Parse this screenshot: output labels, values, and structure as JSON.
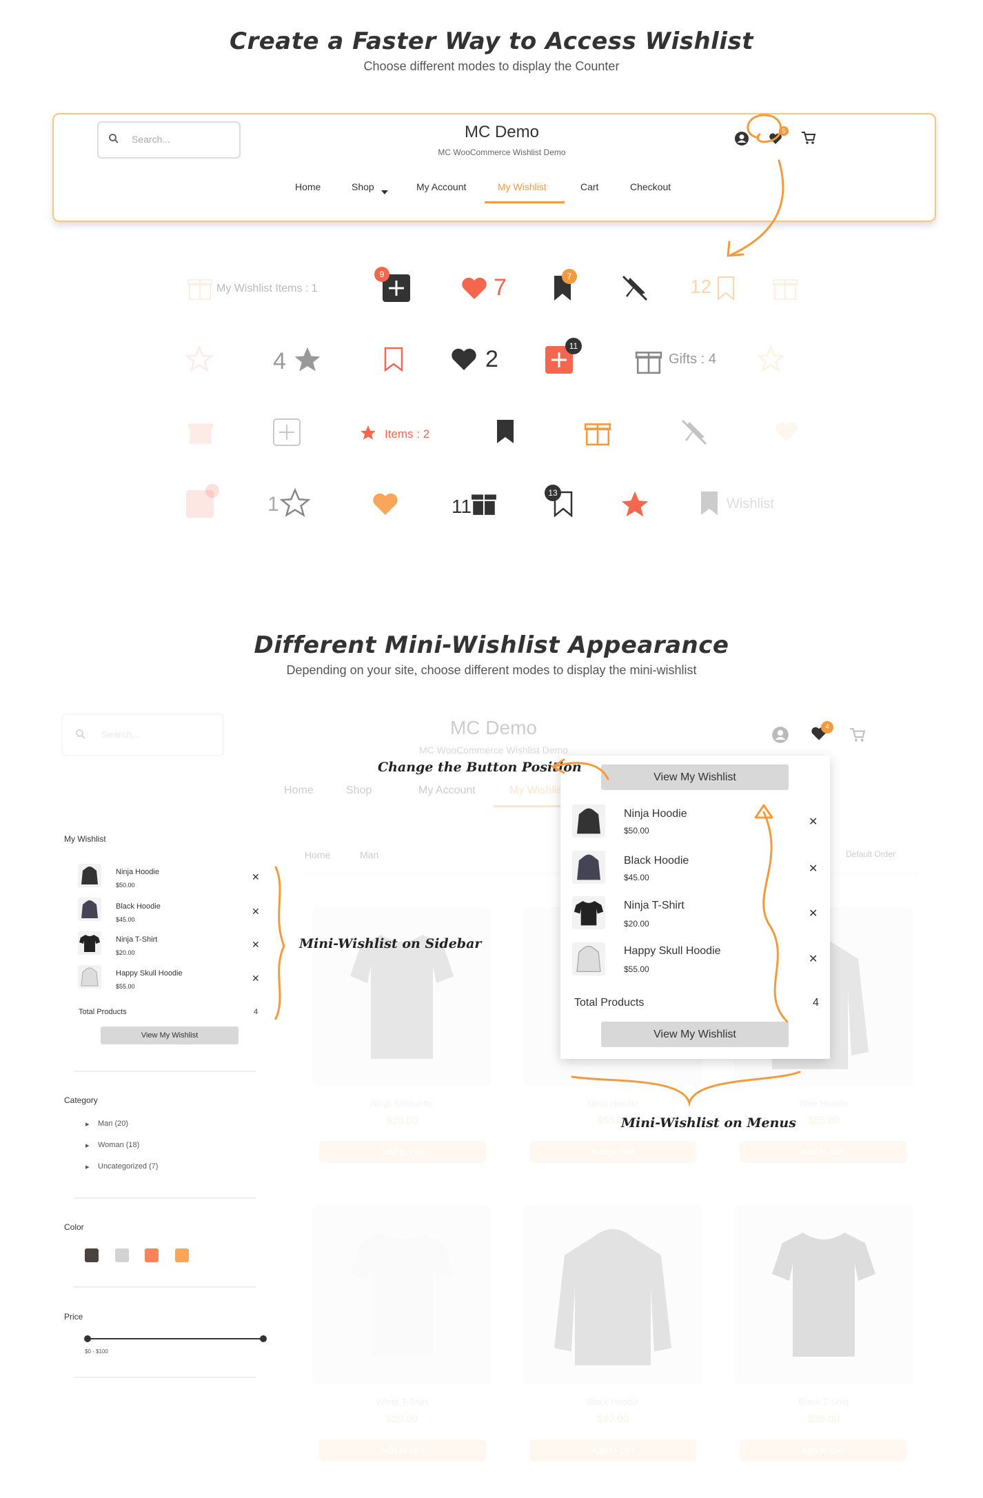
{
  "section1": {
    "title": "Create a Faster Way to Access Wishlist",
    "subtitle": "Choose different modes to display the Counter"
  },
  "demo_header": {
    "search_placeholder": "Search...",
    "site_title": "MC Demo",
    "tagline": "MC WooCommerce Wishlist Demo",
    "wishlist_badge": "5",
    "nav": [
      "Home",
      "Shop",
      "My Account",
      "My Wishlist",
      "Cart",
      "Checkout"
    ]
  },
  "counters": {
    "row1": {
      "my_wishlist_items": "My Wishlist Items : 1",
      "plus_badge": "9",
      "heart_count": "7",
      "bookmark_badge": "7",
      "bookmark_count": "12"
    },
    "row2": {
      "star_count": "4",
      "heart_count": "2",
      "plus_badge": "11",
      "gifts": "Gifts : 4"
    },
    "row3": {
      "items": "Items : 2"
    },
    "row4": {
      "star_count": "1",
      "gift_count": "11",
      "bookmark_badge": "13",
      "wishlist": "Wishlist"
    }
  },
  "section2": {
    "title": "Different Mini-Wishlist Appearance",
    "subtitle": "Depending on your site, choose different modes to display the mini-wishlist"
  },
  "mock_store": {
    "search_placeholder": "Search...",
    "site_title": "MC Demo",
    "tagline": "MC WooCommerce Wishlist Demo",
    "wishlist_badge": "4",
    "nav": [
      "Home",
      "Shop",
      "My Account",
      "My Wishlist"
    ],
    "breadcrumb": [
      "Home",
      "Man"
    ],
    "sort": "Default Order",
    "add_to_cart": "Add to cart",
    "products": [
      {
        "name": "Ninja Silhouette",
        "price": "$20.00"
      },
      {
        "name": "Ninja Hoodie",
        "price": "$50.00"
      },
      {
        "name": "Woo Hoodie",
        "price": "$55.00"
      },
      {
        "name": "White T-Shirt",
        "price": "$20.00"
      },
      {
        "name": "Black Hoodie",
        "price": "$40.00"
      },
      {
        "name": "Black T-Shirt",
        "price": "$25.00"
      }
    ]
  },
  "sidebar": {
    "wishlist_title": "My Wishlist",
    "items": [
      {
        "name": "Ninja Hoodie",
        "price": "$50.00"
      },
      {
        "name": "Black Hoodie",
        "price": "$45.00"
      },
      {
        "name": "Ninja T-Shirt",
        "price": "$20.00"
      },
      {
        "name": "Happy Skull Hoodie",
        "price": "$55.00"
      }
    ],
    "total_label": "Total Products",
    "total_value": "4",
    "view_button": "View My Wishlist",
    "category_title": "Category",
    "categories": [
      "Man (20)",
      "Woman (18)",
      "Uncategorized (7)"
    ],
    "color_title": "Color",
    "colors": [
      "#4a4440",
      "#d3d3d3",
      "#f7845a",
      "#f9a55a"
    ],
    "price_title": "Price",
    "price_range": "$0 - $100"
  },
  "popup": {
    "top_button": "View My Wishlist",
    "items": [
      {
        "name": "Ninja Hoodie",
        "price": "$50.00"
      },
      {
        "name": "Black Hoodie",
        "price": "$45.00"
      },
      {
        "name": "Ninja T-Shirt",
        "price": "$20.00"
      },
      {
        "name": "Happy Skull Hoodie",
        "price": "$55.00"
      }
    ],
    "total_label": "Total Products",
    "total_value": "4",
    "bottom_button": "View My Wishlist"
  },
  "annotations": {
    "change_position": "Change the Button Position",
    "on_sidebar": "Mini-Wishlist on Sidebar",
    "on_menus": "Mini-Wishlist on Menus"
  },
  "colors": {
    "accent": "#f39a3d",
    "red": "#f4664d",
    "dark": "#333333"
  }
}
